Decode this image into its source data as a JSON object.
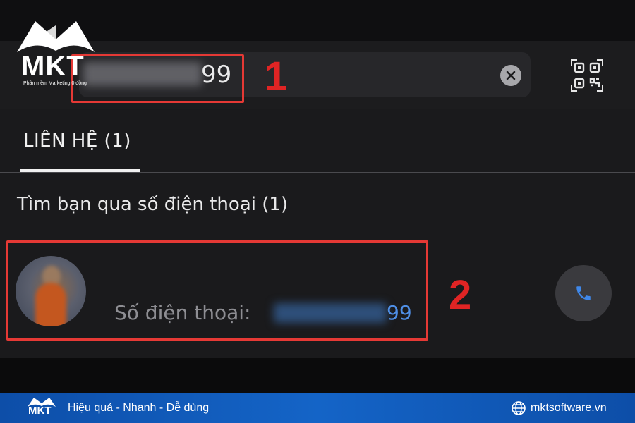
{
  "colors": {
    "background": "#1a1a1c",
    "annotation_red": "#e53935",
    "link_blue": "#4f8fe6",
    "brand_blue": "#1464c7"
  },
  "logo": {
    "brand": "MKT",
    "tagline": "Phần mềm Marketing 0 đồng"
  },
  "search": {
    "visible_suffix": "99",
    "clear_icon": "close-circle-icon",
    "qr_icon": "qr-code-icon"
  },
  "annotations": {
    "step_1": "1",
    "step_2": "2"
  },
  "tabs": [
    {
      "label": "LIÊN HỆ (1)",
      "active": true
    }
  ],
  "section": {
    "title": "Tìm bạn qua số điện thoại (1)"
  },
  "result": {
    "phone_label": "Số điện thoại:",
    "phone_suffix": "99",
    "call_icon": "phone-icon"
  },
  "footer": {
    "brand": "MKT",
    "tagline": "Hiệu quả - Nhanh - Dễ dùng",
    "website": "mktsoftware.vn",
    "website_icon": "globe-icon"
  }
}
